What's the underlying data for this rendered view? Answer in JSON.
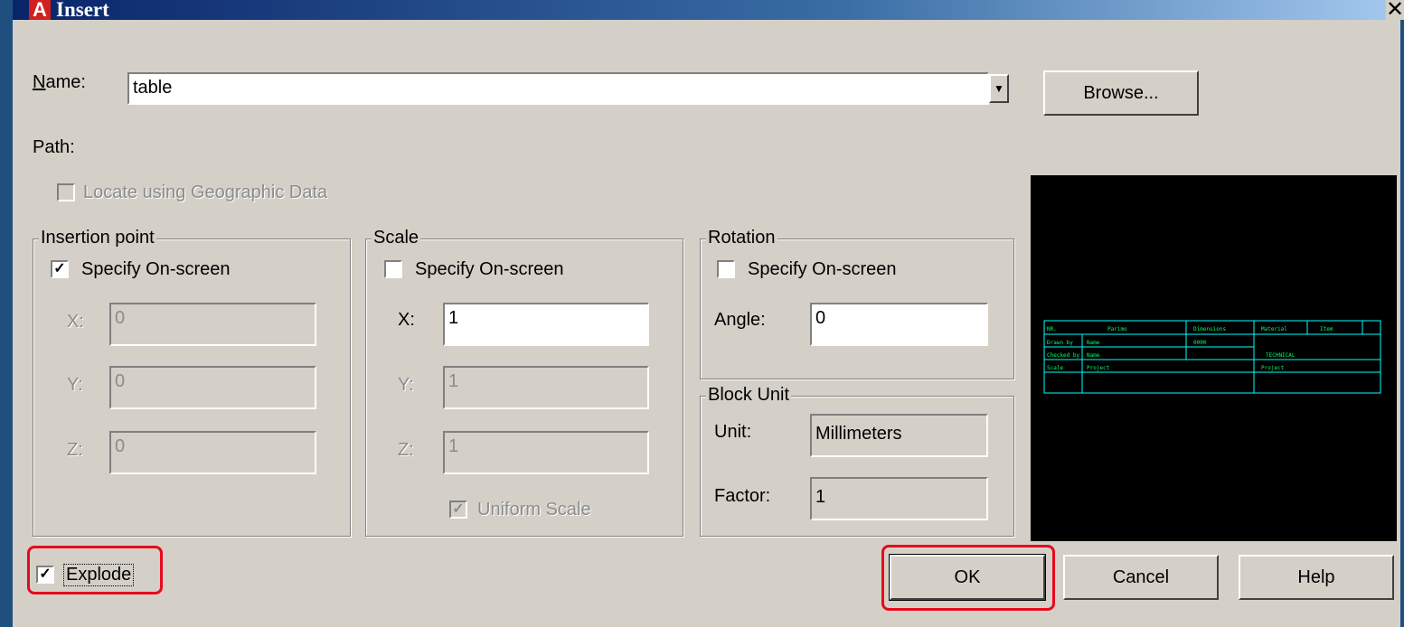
{
  "window": {
    "title": "Insert",
    "close_glyph": "✕"
  },
  "name_label": "Name:",
  "name_value": "table",
  "browse_label": "Browse...",
  "path_label": "Path:",
  "geo_label": "Locate using Geographic Data",
  "insertion": {
    "title": "Insertion point",
    "specify_label": "Specify On-screen",
    "specify_checked": true,
    "x_label": "X:",
    "x_value": "0",
    "y_label": "Y:",
    "y_value": "0",
    "z_label": "Z:",
    "z_value": "0"
  },
  "scale": {
    "title": "Scale",
    "specify_label": "Specify On-screen",
    "specify_checked": false,
    "x_label": "X:",
    "x_value": "1",
    "y_label": "Y:",
    "y_value": "1",
    "z_label": "Z:",
    "z_value": "1",
    "uniform_label": "Uniform Scale",
    "uniform_checked": true
  },
  "rotation": {
    "title": "Rotation",
    "specify_label": "Specify On-screen",
    "specify_checked": false,
    "angle_label": "Angle:",
    "angle_value": "0"
  },
  "block_unit": {
    "title": "Block Unit",
    "unit_label": "Unit:",
    "unit_value": "Millimeters",
    "factor_label": "Factor:",
    "factor_value": "1"
  },
  "explode_label": "Explode",
  "explode_checked": true,
  "buttons": {
    "ok": "OK",
    "cancel": "Cancel",
    "help": "Help"
  },
  "colors": {
    "preview_line": "#00ffff",
    "preview_text": "#00ff66",
    "highlight": "#e8091c"
  }
}
